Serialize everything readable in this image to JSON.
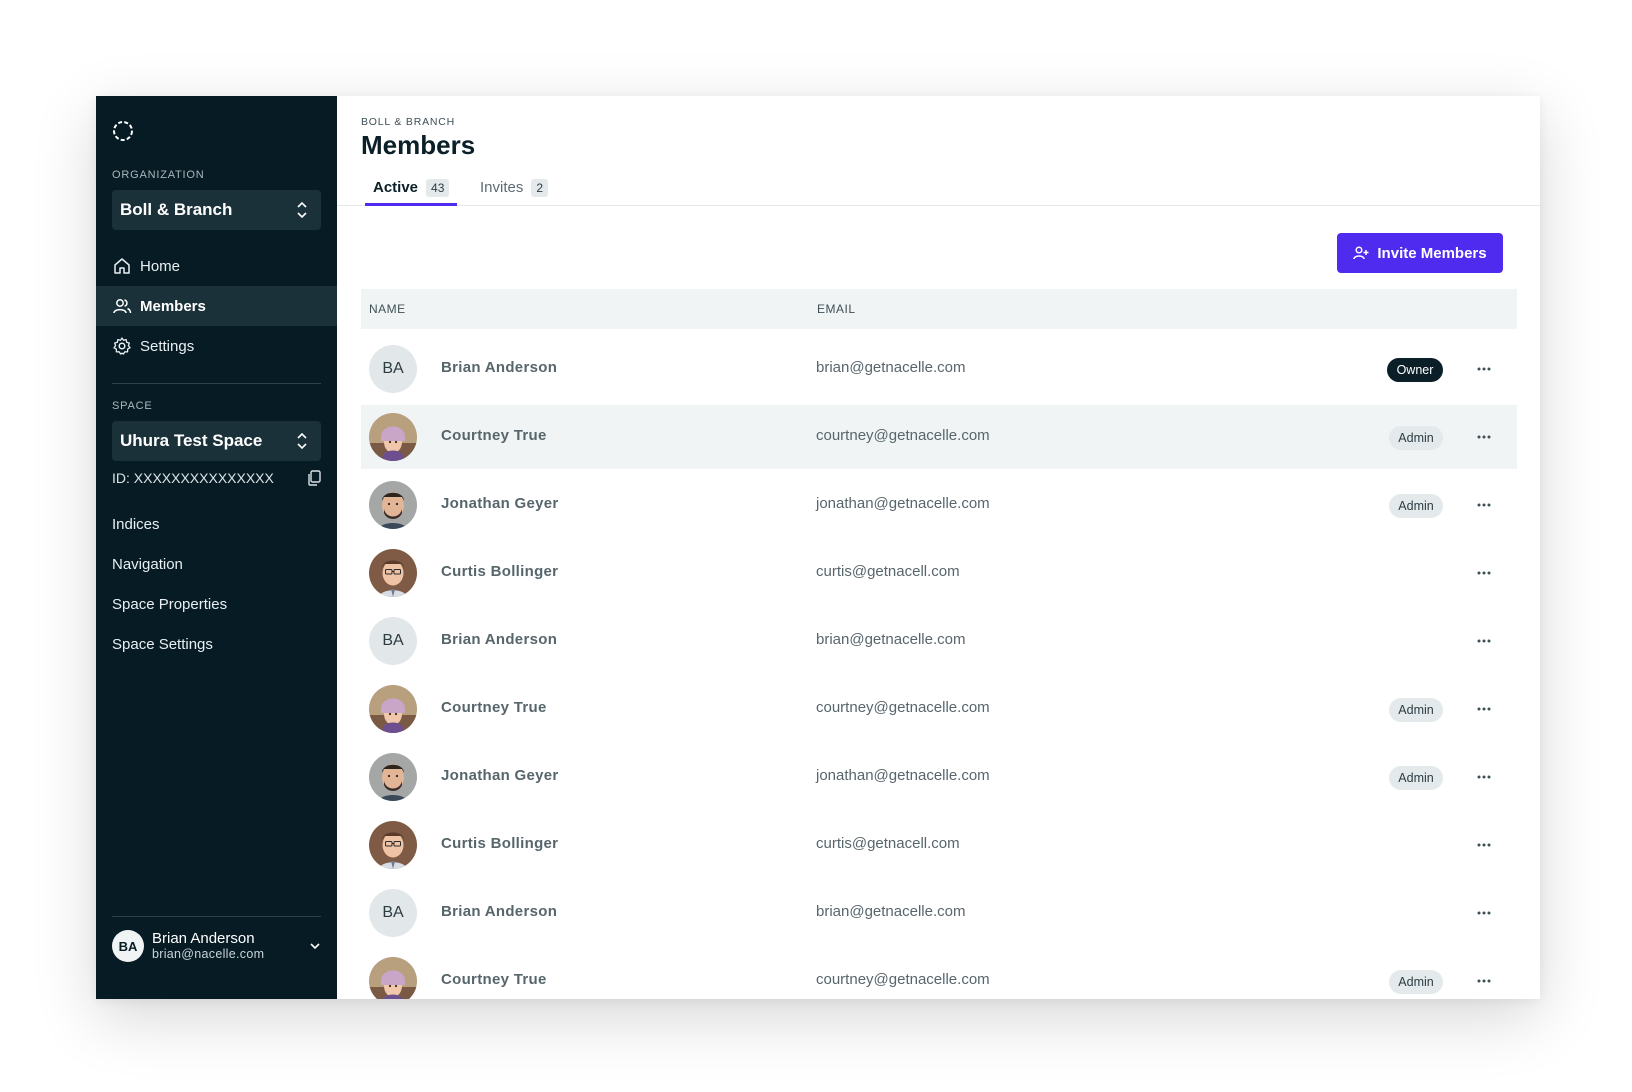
{
  "sidebar": {
    "org_label": "ORGANIZATION",
    "org_name": "Boll & Branch",
    "nav": [
      {
        "label": "Home",
        "icon": "home-icon"
      },
      {
        "label": "Members",
        "icon": "users-icon",
        "active": true
      },
      {
        "label": "Settings",
        "icon": "gear-icon"
      }
    ],
    "space_label": "SPACE",
    "space_name": "Uhura Test Space",
    "space_id": "ID: XXXXXXXXXXXXXXX",
    "space_links": [
      "Indices",
      "Navigation",
      "Space Properties",
      "Space Settings"
    ],
    "user": {
      "initials": "BA",
      "name": "Brian Anderson",
      "email": "brian@nacelle.com"
    }
  },
  "header": {
    "breadcrumb": "BOLL & BRANCH",
    "title": "Members"
  },
  "tabs": [
    {
      "label": "Active",
      "count": "43",
      "active": true
    },
    {
      "label": "Invites",
      "count": "2",
      "active": false
    }
  ],
  "invite_button": "Invite Members",
  "table": {
    "columns": [
      "NAME",
      "EMAIL"
    ],
    "rows": [
      {
        "name": "Brian Anderson",
        "email": "brian@getnacelle.com",
        "avatar": "BA",
        "role": "Owner"
      },
      {
        "name": "Courtney True",
        "email": "courtney@getnacelle.com",
        "avatar": "photo-courtney",
        "role": "Admin"
      },
      {
        "name": "Jonathan Geyer",
        "email": "jonathan@getnacelle.com",
        "avatar": "photo-jonathan",
        "role": "Admin"
      },
      {
        "name": "Curtis Bollinger",
        "email": "curtis@getnacell.com",
        "avatar": "photo-curtis",
        "role": ""
      },
      {
        "name": "Brian Anderson",
        "email": "brian@getnacelle.com",
        "avatar": "BA",
        "role": ""
      },
      {
        "name": "Courtney True",
        "email": "courtney@getnacelle.com",
        "avatar": "photo-courtney",
        "role": "Admin"
      },
      {
        "name": "Jonathan Geyer",
        "email": "jonathan@getnacelle.com",
        "avatar": "photo-jonathan",
        "role": "Admin"
      },
      {
        "name": "Curtis Bollinger",
        "email": "curtis@getnacell.com",
        "avatar": "photo-curtis",
        "role": ""
      },
      {
        "name": "Brian Anderson",
        "email": "brian@getnacelle.com",
        "avatar": "BA",
        "role": ""
      },
      {
        "name": "Courtney True",
        "email": "courtney@getnacelle.com",
        "avatar": "photo-courtney",
        "role": "Admin"
      }
    ]
  },
  "colors": {
    "sidebar_bg": "#061b24",
    "accent": "#4f2bf0",
    "row_hover": "#f1f4f5"
  }
}
